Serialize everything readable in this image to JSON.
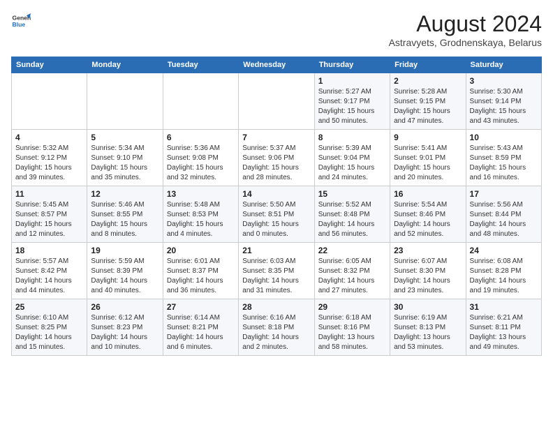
{
  "logo": {
    "line1": "General",
    "line2": "Blue"
  },
  "title": "August 2024",
  "subtitle": "Astravyets, Grodnenskaya, Belarus",
  "calendar": {
    "headers": [
      "Sunday",
      "Monday",
      "Tuesday",
      "Wednesday",
      "Thursday",
      "Friday",
      "Saturday"
    ],
    "weeks": [
      [
        {
          "day": "",
          "info": ""
        },
        {
          "day": "",
          "info": ""
        },
        {
          "day": "",
          "info": ""
        },
        {
          "day": "",
          "info": ""
        },
        {
          "day": "1",
          "info": "Sunrise: 5:27 AM\nSunset: 9:17 PM\nDaylight: 15 hours\nand 50 minutes."
        },
        {
          "day": "2",
          "info": "Sunrise: 5:28 AM\nSunset: 9:15 PM\nDaylight: 15 hours\nand 47 minutes."
        },
        {
          "day": "3",
          "info": "Sunrise: 5:30 AM\nSunset: 9:14 PM\nDaylight: 15 hours\nand 43 minutes."
        }
      ],
      [
        {
          "day": "4",
          "info": "Sunrise: 5:32 AM\nSunset: 9:12 PM\nDaylight: 15 hours\nand 39 minutes."
        },
        {
          "day": "5",
          "info": "Sunrise: 5:34 AM\nSunset: 9:10 PM\nDaylight: 15 hours\nand 35 minutes."
        },
        {
          "day": "6",
          "info": "Sunrise: 5:36 AM\nSunset: 9:08 PM\nDaylight: 15 hours\nand 32 minutes."
        },
        {
          "day": "7",
          "info": "Sunrise: 5:37 AM\nSunset: 9:06 PM\nDaylight: 15 hours\nand 28 minutes."
        },
        {
          "day": "8",
          "info": "Sunrise: 5:39 AM\nSunset: 9:04 PM\nDaylight: 15 hours\nand 24 minutes."
        },
        {
          "day": "9",
          "info": "Sunrise: 5:41 AM\nSunset: 9:01 PM\nDaylight: 15 hours\nand 20 minutes."
        },
        {
          "day": "10",
          "info": "Sunrise: 5:43 AM\nSunset: 8:59 PM\nDaylight: 15 hours\nand 16 minutes."
        }
      ],
      [
        {
          "day": "11",
          "info": "Sunrise: 5:45 AM\nSunset: 8:57 PM\nDaylight: 15 hours\nand 12 minutes."
        },
        {
          "day": "12",
          "info": "Sunrise: 5:46 AM\nSunset: 8:55 PM\nDaylight: 15 hours\nand 8 minutes."
        },
        {
          "day": "13",
          "info": "Sunrise: 5:48 AM\nSunset: 8:53 PM\nDaylight: 15 hours\nand 4 minutes."
        },
        {
          "day": "14",
          "info": "Sunrise: 5:50 AM\nSunset: 8:51 PM\nDaylight: 15 hours\nand 0 minutes."
        },
        {
          "day": "15",
          "info": "Sunrise: 5:52 AM\nSunset: 8:48 PM\nDaylight: 14 hours\nand 56 minutes."
        },
        {
          "day": "16",
          "info": "Sunrise: 5:54 AM\nSunset: 8:46 PM\nDaylight: 14 hours\nand 52 minutes."
        },
        {
          "day": "17",
          "info": "Sunrise: 5:56 AM\nSunset: 8:44 PM\nDaylight: 14 hours\nand 48 minutes."
        }
      ],
      [
        {
          "day": "18",
          "info": "Sunrise: 5:57 AM\nSunset: 8:42 PM\nDaylight: 14 hours\nand 44 minutes."
        },
        {
          "day": "19",
          "info": "Sunrise: 5:59 AM\nSunset: 8:39 PM\nDaylight: 14 hours\nand 40 minutes."
        },
        {
          "day": "20",
          "info": "Sunrise: 6:01 AM\nSunset: 8:37 PM\nDaylight: 14 hours\nand 36 minutes."
        },
        {
          "day": "21",
          "info": "Sunrise: 6:03 AM\nSunset: 8:35 PM\nDaylight: 14 hours\nand 31 minutes."
        },
        {
          "day": "22",
          "info": "Sunrise: 6:05 AM\nSunset: 8:32 PM\nDaylight: 14 hours\nand 27 minutes."
        },
        {
          "day": "23",
          "info": "Sunrise: 6:07 AM\nSunset: 8:30 PM\nDaylight: 14 hours\nand 23 minutes."
        },
        {
          "day": "24",
          "info": "Sunrise: 6:08 AM\nSunset: 8:28 PM\nDaylight: 14 hours\nand 19 minutes."
        }
      ],
      [
        {
          "day": "25",
          "info": "Sunrise: 6:10 AM\nSunset: 8:25 PM\nDaylight: 14 hours\nand 15 minutes."
        },
        {
          "day": "26",
          "info": "Sunrise: 6:12 AM\nSunset: 8:23 PM\nDaylight: 14 hours\nand 10 minutes."
        },
        {
          "day": "27",
          "info": "Sunrise: 6:14 AM\nSunset: 8:21 PM\nDaylight: 14 hours\nand 6 minutes."
        },
        {
          "day": "28",
          "info": "Sunrise: 6:16 AM\nSunset: 8:18 PM\nDaylight: 14 hours\nand 2 minutes."
        },
        {
          "day": "29",
          "info": "Sunrise: 6:18 AM\nSunset: 8:16 PM\nDaylight: 13 hours\nand 58 minutes."
        },
        {
          "day": "30",
          "info": "Sunrise: 6:19 AM\nSunset: 8:13 PM\nDaylight: 13 hours\nand 53 minutes."
        },
        {
          "day": "31",
          "info": "Sunrise: 6:21 AM\nSunset: 8:11 PM\nDaylight: 13 hours\nand 49 minutes."
        }
      ]
    ]
  }
}
